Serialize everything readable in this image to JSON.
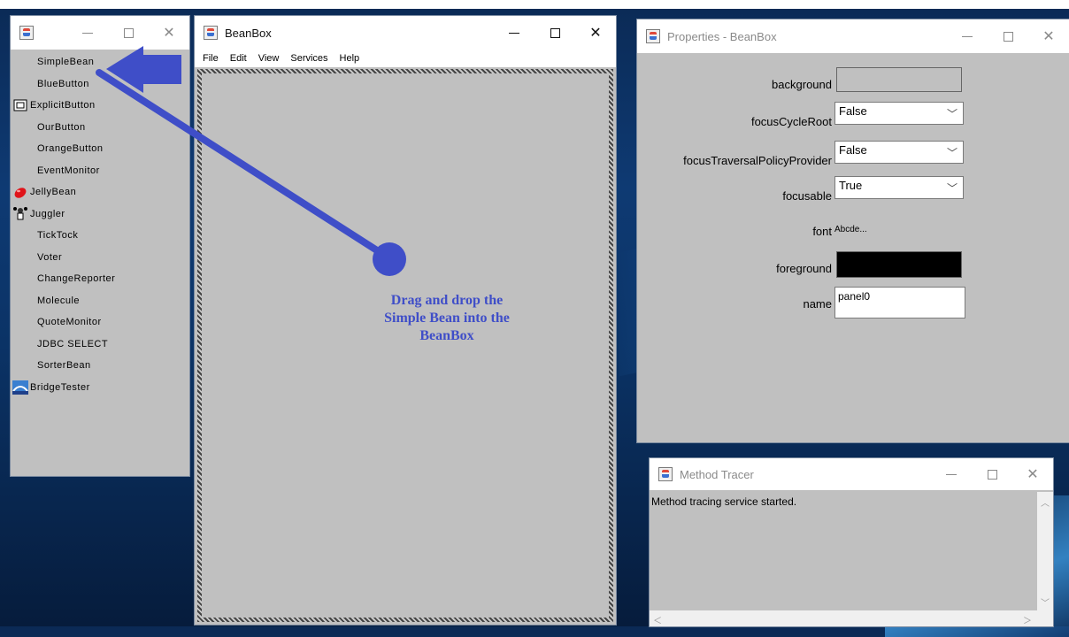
{
  "toolbox": {
    "items": [
      {
        "label": "SimpleBean",
        "icon": ""
      },
      {
        "label": "BlueButton",
        "icon": ""
      },
      {
        "label": "ExplicitButton",
        "icon": "button-icon"
      },
      {
        "label": "OurButton",
        "icon": ""
      },
      {
        "label": "OrangeButton",
        "icon": ""
      },
      {
        "label": "EventMonitor",
        "icon": ""
      },
      {
        "label": "JellyBean",
        "icon": "jellybean-icon"
      },
      {
        "label": "Juggler",
        "icon": "juggler-icon"
      },
      {
        "label": "TickTock",
        "icon": ""
      },
      {
        "label": "Voter",
        "icon": ""
      },
      {
        "label": "ChangeReporter",
        "icon": ""
      },
      {
        "label": "Molecule",
        "icon": ""
      },
      {
        "label": "QuoteMonitor",
        "icon": ""
      },
      {
        "label": "JDBC SELECT",
        "icon": ""
      },
      {
        "label": "SorterBean",
        "icon": ""
      },
      {
        "label": "BridgeTester",
        "icon": "bridge-icon"
      }
    ]
  },
  "beanbox": {
    "title": "BeanBox",
    "menu": [
      "File",
      "Edit",
      "View",
      "Services",
      "Help"
    ]
  },
  "properties": {
    "title": "Properties - BeanBox",
    "rows": {
      "background": {
        "label": "background"
      },
      "focusCycleRoot": {
        "label": "focusCycleRoot",
        "value": "False"
      },
      "focusTraversalPolicyProvider": {
        "label": "focusTraversalPolicyProvider",
        "value": "False"
      },
      "focusable": {
        "label": "focusable",
        "value": "True"
      },
      "font": {
        "label": "font",
        "value": "Abcde..."
      },
      "foreground": {
        "label": "foreground"
      },
      "name": {
        "label": "name",
        "value": "panel0"
      }
    }
  },
  "tracer": {
    "title": "Method Tracer",
    "text": "Method tracing service started."
  },
  "annotation": {
    "line1": "Drag and drop the",
    "line2": "Simple Bean into the",
    "line3": "BeanBox",
    "color": "#3f4ec8"
  }
}
